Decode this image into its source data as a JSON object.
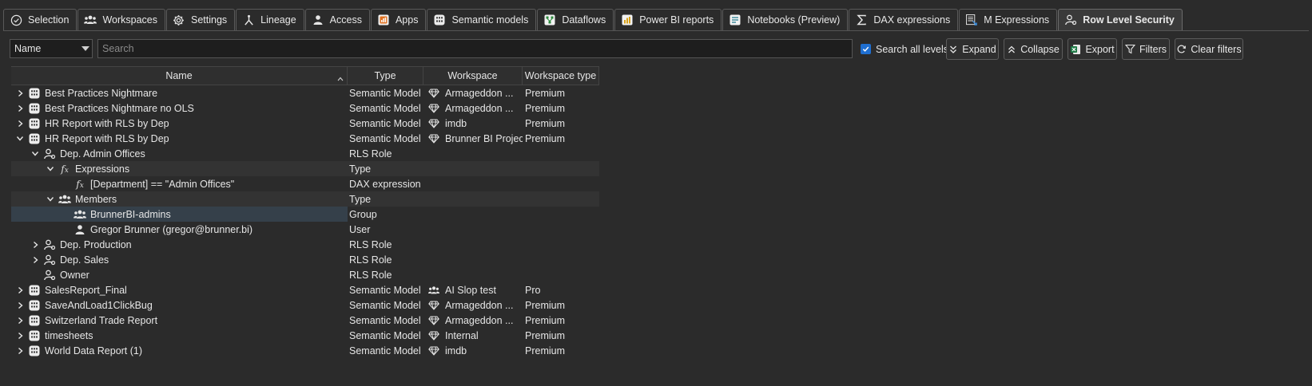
{
  "tabs": [
    {
      "label": "Selection",
      "icon": "check-circle-icon",
      "active": false
    },
    {
      "label": "Workspaces",
      "icon": "people-icon",
      "active": false
    },
    {
      "label": "Settings",
      "icon": "gear-icon",
      "active": false
    },
    {
      "label": "Lineage",
      "icon": "lineage-icon",
      "active": false
    },
    {
      "label": "Access",
      "icon": "person-icon",
      "active": false
    },
    {
      "label": "Apps",
      "icon": "app-icon",
      "active": false
    },
    {
      "label": "Semantic models",
      "icon": "semantic-model-icon",
      "active": false
    },
    {
      "label": "Dataflows",
      "icon": "dataflow-icon",
      "active": false
    },
    {
      "label": "Power BI reports",
      "icon": "report-icon",
      "active": false
    },
    {
      "label": "Notebooks (Preview)",
      "icon": "notebook-icon",
      "active": false
    },
    {
      "label": "DAX expressions",
      "icon": "sigma-icon",
      "active": false
    },
    {
      "label": "M Expressions",
      "icon": "m-expression-icon",
      "active": false
    },
    {
      "label": "Row Level Security",
      "icon": "role-icon",
      "active": true
    }
  ],
  "toolbar": {
    "field_select": "Name",
    "search_placeholder": "Search",
    "search_all_levels_label": "Search all levels",
    "search_all_levels_checked": true,
    "expand_label": "Expand",
    "collapse_label": "Collapse",
    "export_label": "Export",
    "filters_label": "Filters",
    "clear_filters_label": "Clear filters"
  },
  "grid": {
    "columns": [
      "Name",
      "Type",
      "Workspace",
      "Workspace type"
    ],
    "rows": [
      {
        "level": 0,
        "expander": "collapsed",
        "icon": "semantic-model-icon",
        "name": "Best Practices Nightmare",
        "type": "Semantic Model",
        "ws_icon": "diamond-icon",
        "workspace": "Armageddon ...",
        "workspace_type": "Premium",
        "alt": false,
        "selected": false
      },
      {
        "level": 0,
        "expander": "collapsed",
        "icon": "semantic-model-icon",
        "name": "Best Practices Nightmare no OLS",
        "type": "Semantic Model",
        "ws_icon": "diamond-icon",
        "workspace": "Armageddon ...",
        "workspace_type": "Premium",
        "alt": false,
        "selected": false
      },
      {
        "level": 0,
        "expander": "collapsed",
        "icon": "semantic-model-icon",
        "name": "HR Report with RLS by Dep",
        "type": "Semantic Model",
        "ws_icon": "diamond-icon",
        "workspace": "imdb",
        "workspace_type": "Premium",
        "alt": false,
        "selected": false
      },
      {
        "level": 0,
        "expander": "expanded",
        "icon": "semantic-model-icon",
        "name": "HR Report with RLS by Dep",
        "type": "Semantic Model",
        "ws_icon": "diamond-icon",
        "workspace": "Brunner BI Projects",
        "workspace_type": "Premium",
        "alt": false,
        "selected": false
      },
      {
        "level": 1,
        "expander": "expanded",
        "icon": "role-icon",
        "name": "Dep. Admin Offices",
        "type": "RLS Role",
        "ws_icon": "",
        "workspace": "",
        "workspace_type": "",
        "alt": false,
        "selected": false
      },
      {
        "level": 2,
        "expander": "expanded",
        "icon": "fx-icon",
        "name": "Expressions",
        "type": "Type",
        "ws_icon": "",
        "workspace": "",
        "workspace_type": "",
        "alt": true,
        "selected": false
      },
      {
        "level": 3,
        "expander": "none",
        "icon": "fx-icon",
        "name": "[Department] == \"Admin Offices\"",
        "type": "DAX expression",
        "ws_icon": "",
        "workspace": "",
        "workspace_type": "",
        "alt": false,
        "selected": false
      },
      {
        "level": 2,
        "expander": "expanded",
        "icon": "group-icon",
        "name": "Members",
        "type": "Type",
        "ws_icon": "",
        "workspace": "",
        "workspace_type": "",
        "alt": true,
        "selected": false
      },
      {
        "level": 3,
        "expander": "none",
        "icon": "group-icon",
        "name": "BrunnerBI-admins",
        "type": "Group",
        "ws_icon": "",
        "workspace": "",
        "workspace_type": "",
        "alt": false,
        "selected": true
      },
      {
        "level": 3,
        "expander": "none",
        "icon": "person-icon",
        "name": "Gregor Brunner (gregor@brunner.bi)",
        "type": "User",
        "ws_icon": "",
        "workspace": "",
        "workspace_type": "",
        "alt": false,
        "selected": false
      },
      {
        "level": 1,
        "expander": "collapsed",
        "icon": "role-icon",
        "name": "Dep. Production",
        "type": "RLS Role",
        "ws_icon": "",
        "workspace": "",
        "workspace_type": "",
        "alt": false,
        "selected": false
      },
      {
        "level": 1,
        "expander": "collapsed",
        "icon": "role-icon",
        "name": "Dep. Sales",
        "type": "RLS Role",
        "ws_icon": "",
        "workspace": "",
        "workspace_type": "",
        "alt": false,
        "selected": false
      },
      {
        "level": 1,
        "expander": "none",
        "icon": "role-icon",
        "name": "Owner",
        "type": "RLS Role",
        "ws_icon": "",
        "workspace": "",
        "workspace_type": "",
        "alt": false,
        "selected": false
      },
      {
        "level": 0,
        "expander": "collapsed",
        "icon": "semantic-model-icon",
        "name": "SalesReport_Final",
        "type": "Semantic Model",
        "ws_icon": "group-icon",
        "workspace": "AI Slop test",
        "workspace_type": "Pro",
        "alt": false,
        "selected": false
      },
      {
        "level": 0,
        "expander": "collapsed",
        "icon": "semantic-model-icon",
        "name": "SaveAndLoad1ClickBug",
        "type": "Semantic Model",
        "ws_icon": "diamond-icon",
        "workspace": "Armageddon ...",
        "workspace_type": "Premium",
        "alt": false,
        "selected": false
      },
      {
        "level": 0,
        "expander": "collapsed",
        "icon": "semantic-model-icon",
        "name": "Switzerland Trade Report",
        "type": "Semantic Model",
        "ws_icon": "diamond-icon",
        "workspace": "Armageddon ...",
        "workspace_type": "Premium",
        "alt": false,
        "selected": false
      },
      {
        "level": 0,
        "expander": "collapsed",
        "icon": "semantic-model-icon",
        "name": "timesheets",
        "type": "Semantic Model",
        "ws_icon": "diamond-icon",
        "workspace": "Internal",
        "workspace_type": "Premium",
        "alt": false,
        "selected": false
      },
      {
        "level": 0,
        "expander": "collapsed",
        "icon": "semantic-model-icon",
        "name": "World Data Report (1)",
        "type": "Semantic Model",
        "ws_icon": "diamond-icon",
        "workspace": "imdb",
        "workspace_type": "Premium",
        "alt": false,
        "selected": false
      }
    ]
  },
  "colors": {
    "background": "#2b2b2b",
    "accent": "#1f6fd1",
    "selection": "#35404a",
    "text": "#e6e6e6"
  }
}
